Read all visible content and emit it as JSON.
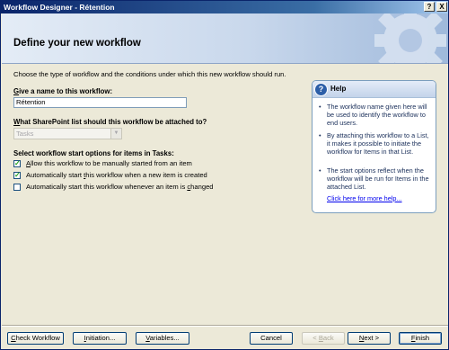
{
  "window": {
    "title": "Workflow Designer - Rétention",
    "help_button": "?",
    "close_button": "X"
  },
  "header": {
    "title": "Define your new workflow"
  },
  "intro_text": "Choose the type of workflow and the conditions under which this new workflow should run.",
  "name_section": {
    "label_underline": "G",
    "label_rest": "ive a name to this workflow:",
    "value": "Rétention"
  },
  "list_section": {
    "label_underline": "W",
    "label_rest": "hat SharePoint list should this workflow be attached to?",
    "selected": "Tasks"
  },
  "start_section": {
    "label": "Select workflow start options for items in Tasks:",
    "options": [
      {
        "pre": "",
        "ul": "A",
        "post": "llow this workflow to be manually started from an item",
        "checked": true
      },
      {
        "pre": "Automatically start ",
        "ul": "t",
        "post": "his workflow when a new item is created",
        "checked": true
      },
      {
        "pre": "Automatically start this workflow whenever an item is ",
        "ul": "c",
        "post": "hanged",
        "checked": false
      }
    ]
  },
  "help_panel": {
    "title": "Help",
    "items": [
      "The workflow name given here will be used to identify the workflow to end users.",
      "By attaching this workflow to a List, it makes it possible to initiate the workflow for Items in that List.",
      "The start options reflect when the workflow will be run for Items in the attached List."
    ],
    "link": "Click here for more help..."
  },
  "footer": {
    "check_workflow": {
      "ul": "C",
      "post": "heck Workflow"
    },
    "initiation": {
      "ul": "I",
      "post": "nitiation..."
    },
    "variables": {
      "ul": "V",
      "post": "ariables..."
    },
    "cancel": "Cancel",
    "back": {
      "pre": "< ",
      "ul": "B",
      "post": "ack"
    },
    "next": {
      "ul": "N",
      "post": "ext >"
    },
    "finish": {
      "ul": "F",
      "post": "inish"
    }
  }
}
